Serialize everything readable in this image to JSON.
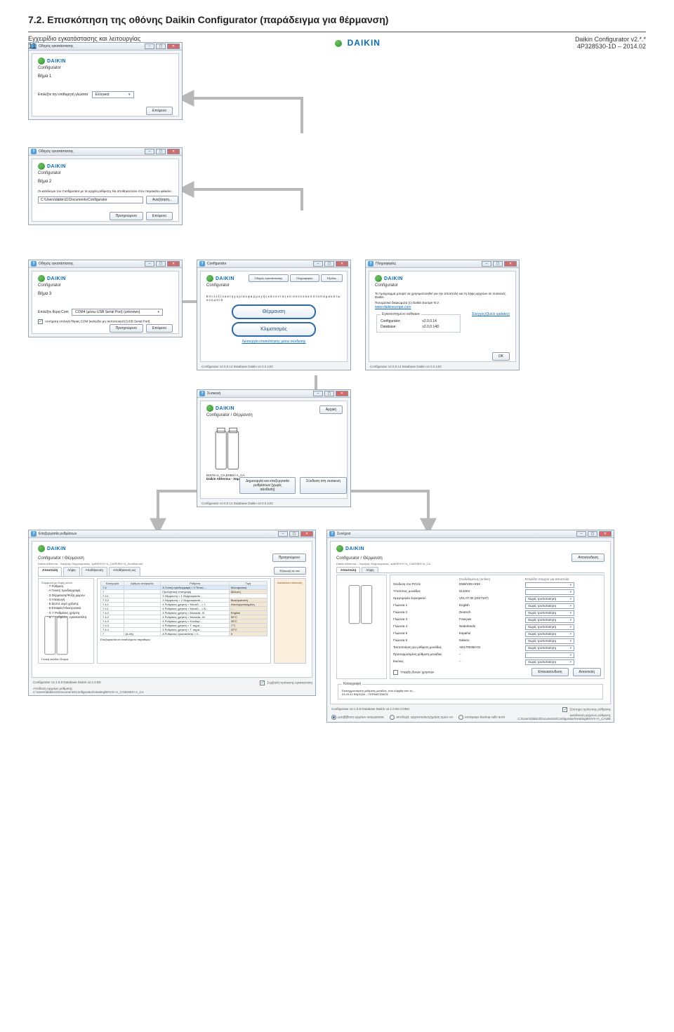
{
  "section_title": "7.2.     Επισκόπηση της οθόνης Daikin Configurator (παράδειγμα για θέρμανση)",
  "brand": "DAIKIN",
  "app_name": "Configurator",
  "wizard_title": "Οδηγός εγκατάστασης",
  "step1": {
    "label": "Βήμα 1",
    "prompt": "Επιλέξτε την επιθυμητή γλώσσα",
    "lang": "Ελληνικά",
    "next": "Επόμενο"
  },
  "step2": {
    "label": "Βήμα 2",
    "prompt": "Οι κατάλογοι του Configurator με τα αρχεία ρύθμισης θα αποθηκευτούν στον παρακάτω φάκελο:",
    "path": "C:\\Users\\daikin11\\Documents\\Configurator",
    "browse": "Αναζήτηση...",
    "back": "Προηγούμενο",
    "next": "Επόμενο"
  },
  "step3": {
    "label": "Βήμα 3",
    "com_label": "Επιλέξτε θύρα Com",
    "com_value": "COM4 (μέσω USB Serial Port) (unknown)",
    "auto": "Αυτόματη επιλογή θύρας COM (καλώδιο μη πιστοποιητό) [USB Serial Port]",
    "back": "Προηγούμενο",
    "next": "Επόμενο"
  },
  "main": {
    "title": "Configurator",
    "top_buttons": [
      "Οδηγός εγκατάστασης",
      "Πληροφορίες",
      "Έξοδος"
    ],
    "hint": "Ε π ι λ έ ξ τ ε   κ α τ η γ ο ρ ί α   ε φ α ρ μ ο γ ή ς   κ ά ν ο ν τ α ς   κ λ ι κ   σ ε   έ ν α   α π ό   τ α   π α ρ α κ ά τ ω   κ ο υ μ π ι ά",
    "btn_heat": "Θέρμανση",
    "btn_cool": "Κλιματισμός",
    "link": "Λειτουργία επισκόπησης μέσω σύνδεσης",
    "status": "Configurator v2.0.0.14  Database Daikin v2.0.0.14D"
  },
  "about": {
    "title": "Πληροφορίες",
    "body": "Το πρόγραμμα μπορεί να χρησιμοποιηθεί για την αποστολή και τη λήψη αρχείων σε συσκευές Daikin.",
    "copy": "Πνευματικά δικαιώματα (c) Daikin Europe N.V.",
    "url": "www.daikineurope.com",
    "box_title": "Εγκατεστημένο software",
    "update": "Έλεγχος(Quick updates)",
    "rows": [
      [
        "Configurator:",
        "v2.0.0.14"
      ],
      [
        "Database:",
        "v2.0.0.14D"
      ]
    ],
    "ok": "OK",
    "status": "Configurator v2.0.0.14  Database Daikin v2.0.0.14D"
  },
  "heating_sel": {
    "win_title": "Συσκευή",
    "title": "Configurator / Θέρμανση",
    "btn_start": "Αρχική",
    "model": "EHVX+A_CA,EHBX+A_CA",
    "line2": "Daikin Altherma - Χαμηλής Θερμοκρασίας, split",
    "btn_make": "Δημιουργία και επεξεργασία  ρυθμίσεων (χωρίς σύνδεση)",
    "btn_conn": "Σύνδεση στη συσκευή",
    "status": "Configurator v2.0.0.14  Database Daikin v2.0.0.14D"
  },
  "settings": {
    "win_title": "Επεξεργασία ρυθμίσεων",
    "title": "Configurator / Θέρμανση",
    "crumb": "Daikin Altherma - Χαμηλής Θερμοκρασίας, split/EHVX+A_CA/EHBX+A_Smallset.set",
    "back": "Προηγούμενο",
    "tabs": [
      "Αποστολή",
      "Λήψη",
      "Αποθήκευση",
      "Αποθήκευση ως"
    ],
    "export": "Εξαγωγή σε csv",
    "tree_title": "Σύμφωνα με δομή μενού",
    "tree": [
      "7 Ρύθμιση",
      "  A Γενική προδιαγραφή",
      "  3 Θέρμανση/Ψύξη χώρου",
      "  4 Απαγωγή",
      "  5 Ζεστό νερό χρήσης",
      "  6 Επαφές/Ηλεκτρονικά",
      "  C 7 Ρυθμίσεις χρήστη",
      "  B 7 Ρυθμίσεις εγκαταστάτη"
    ],
    "left_sel": "Γενική σελίδα:  Όνομα",
    "cols": [
      "Κατηγορία",
      "Αρθμός αναφοράς",
      "Ρύθμιση",
      "Τιμή"
    ],
    "rows": [
      [
        "7.4",
        "",
        "A Γενική προδιαγραφή > 4 Τύπος ...",
        "Μονοφασική"
      ],
      [
        "7",
        "",
        "Προληπτική επιστροφή",
        "Μείωση"
      ],
      [
        "7.3.1",
        "",
        "3 Θέρμανση > 1 Θερμοκρασία ...",
        ""
      ],
      [
        "7.3.2",
        "",
        "3 Θέρμανση > 2 Θερμοκρασία ...",
        "Βιοκλιματιστή"
      ],
      [
        "7.4.1",
        "",
        "4 Ρυθμίσεις χρήστη > Μονάδ... > 1",
        "Απενεργοποιημένη"
      ],
      [
        "7.4.1",
        "",
        "4 Ρυθμίσεις χρήστη > Μονάδ... > Ά...",
        "–"
      ],
      [
        "7.4.2",
        "",
        "4 Ρυθμίσεις χρήστη > Monada...B",
        "English"
      ],
      [
        "7.4.2",
        "",
        "4 Ρυθμίσεις χρήστη > Monada...M",
        "55°C"
      ],
      [
        "7.4.3",
        "",
        "4 Ρυθμίσεις χρήστη > Κλειδαρ...",
        "35°C"
      ],
      [
        "7.4.3",
        "",
        "4 Ρυθμίσεις χρήστη > T. σημεί...",
        "7°C"
      ],
      [
        "7.4.4",
        "",
        "4 Ρυθμίσεις χρήστη > T. σημεί...",
        "22°C"
      ],
      [
        "7",
        "[A-0A]",
        "A Ρυθμίσεις εγκαταστάτη > Λ...",
        "0"
      ]
    ],
    "table_footer": "Επεξεργασία σε αναδυόμενο παράθυρο",
    "small_note": "Απαιτείται επέκταση",
    "bottom_check": "Συμβολή πρότασης εγκαταστάτη",
    "bottom_path_label": "Απόδοση αρχείων ρύθμισης",
    "bottom_path": "C:\\Users\\daikin11\\Documents\\Configurator\\Heating\\EHVX+A_CA\\EHBX+A_CA",
    "status": "Configurator v2.1.0.8  Database Daikin v2.1.0.8D"
  },
  "conn": {
    "win_title": "Συνέχεια",
    "title": "Configurator / Θέρμανση",
    "crumb": "Daikin Altherma – Χαμηλής Θερμοκρασίας, split/EHVX+A_CA/EHBX+A_CA",
    "btn_init": "Αποσύνδεση",
    "tab": [
      "Αποστολή",
      "Λήψη"
    ],
    "grid_hdrs": [
      "",
      "Συνδεδεμένος (online)",
      "Επιλέξτε στοιχείο για αποστολή"
    ],
    "rows": [
      [
        "Σύνδεση στο PC/σε",
        "ENB/V8S+K9X",
        ""
      ],
      [
        "Υποτύπος μονάδας",
        "814004",
        ""
      ],
      [
        "Ημερομηνία λογισμικού",
        "V01.07.00 (ID27107)",
        "Χωρίς τροποποίηση"
      ],
      [
        "Γλώσσα 1",
        "English",
        "Χωρίς τροποποίηση"
      ],
      [
        "Γλώσσα 2",
        "Deutsch",
        "Χωρίς τροποποίηση"
      ],
      [
        "Γλώσσα 3",
        "Français",
        "Χωρίς τροποποίηση"
      ],
      [
        "Γλώσσα 4",
        "Nederlands",
        "Χωρίς τροποποίηση"
      ],
      [
        "Γλώσσα 5",
        "Español",
        "Χωρίς τροποποίηση"
      ],
      [
        "Γλώσσα 6",
        "Italiano",
        "Χωρίς τροποποίηση"
      ],
      [
        "Ταυτοποίηση για ρύθμιση μονάδας",
        "AD1700350-01",
        "Χωρίς τροποποίηση"
      ],
      [
        "Προσαρμοσμένη ρύθμιση μονάδας",
        "–",
        ""
      ],
      [
        "Εικόνες",
        "–",
        "Χωρίς τροποποίηση"
      ]
    ],
    "chk": "Υπαρξη δυτών χρηστών",
    "btn_resync": "Επανασύνδεση",
    "btn_send": "Αποστολή",
    "result_title": "Καταγραφή",
    "result_line1": "Εκσυγχρονισμένη ρύθμιση μονάδας, που ελήφθη από τη...",
    "result_line2": "03.29.41 EN|32|34 – ΤΕΡΜΑΤΙΣΜΟΣ",
    "foot_left_check": "Σύστημα πρότυπης ρύθμισης",
    "foot_path_label": "Διεύθυνση αρχείων ρύθμισης",
    "foot_path": "C:\\Users\\daikin\\Documents\\Configurator\\Heating\\EHVX+A_CA\\DE",
    "radios": [
      "μεταβίβαση αρχείων κατεργασίας",
      "αποδοχή· αρχικοποίηση/χρήση τιμών on",
      "αντίγραφο backup calls αυτά"
    ],
    "status": "Configurator v2.1.0.8  Database Daikin v2.1.0.8D    COM4"
  },
  "footer": {
    "left1": "Εγχειρίδιο εγκατάστασης και λειτουργίας",
    "left2": "11",
    "mid_mark": "DAIKIN",
    "right1": "Daikin Configurator v2.*.*",
    "right2": "4P328530-1D – 2014.02"
  }
}
